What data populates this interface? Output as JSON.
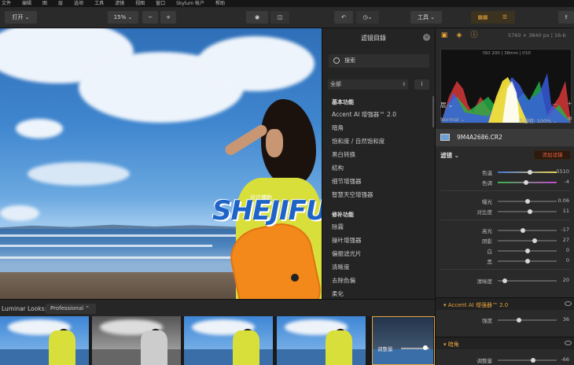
{
  "menu": [
    "文件",
    "编辑",
    "图",
    "层",
    "选项",
    "工具",
    "滤镜",
    "视图",
    "窗口",
    "Skylum 帐户",
    "帮助"
  ],
  "toolbar": {
    "open": "打开 ⌄",
    "zoom": "15% ⌄",
    "zoom_out": "−",
    "zoom_in": "+",
    "tools": "工具 ⌄"
  },
  "canvas": {
    "watermark": "SHEJIFUZHU",
    "watermark_small": "设计辅助"
  },
  "filters": {
    "title": "滤镜目錄",
    "search_placeholder": "搜索",
    "category": "全部",
    "info": "i",
    "sections": [
      {
        "title": "基本功能",
        "items": [
          "Accent AI 增强器™ 2.0",
          "暗角",
          "饱和度 / 自然饱和度",
          "黑白转换",
          "結构",
          "细节增强器",
          "智慧天空增强器"
        ]
      },
      {
        "title": "修补功能",
        "items": [
          "除霧",
          "操叶增强器",
          "偏振滤光片",
          "清晰度",
          "去除色偏",
          "柔化"
        ]
      }
    ]
  },
  "right": {
    "image_info": "5760 × 3840 px | 16-b",
    "hist_info": "ISO 200 | 38mm | f/10",
    "layers_title": "层 ⌄",
    "blend": "Normal ⌄",
    "opacity": "不透明: 100% ⌄",
    "file_name": "9M4A2686.CR2",
    "filters_title": "滤镜 ⌄",
    "add_filter": "添加滤镜",
    "sliders1": [
      {
        "label": "色温",
        "value": "5510",
        "pos": 0.55
      },
      {
        "label": "色调",
        "value": "-4",
        "pos": 0.48
      }
    ],
    "sliders2": [
      {
        "label": "曝光",
        "value": "0.06",
        "pos": 0.51
      },
      {
        "label": "对比度",
        "value": "11",
        "pos": 0.55
      }
    ],
    "sliders3": [
      {
        "label": "高光",
        "value": "-17",
        "pos": 0.43
      },
      {
        "label": "阴影",
        "value": "27",
        "pos": 0.62
      },
      {
        "label": "白",
        "value": "0",
        "pos": 0.5
      },
      {
        "label": "黑",
        "value": "0",
        "pos": 0.5
      }
    ],
    "slider_clarity": {
      "label": "清晰度",
      "value": "20",
      "pos": 0.12
    },
    "accent_title": "Accent AI 增强器™ 2.0",
    "accent_slider": {
      "label": "强度",
      "value": "36",
      "pos": 0.36
    },
    "vignette_title": "暗角",
    "vignette_slider": {
      "label": "调整量",
      "value": "-66",
      "pos": 0.6
    }
  },
  "looks": {
    "label": "Luminar Looks:",
    "preset": "Professional ⌃",
    "adjust_label": "调整量"
  },
  "colors": {
    "accent": "#e7a33a"
  }
}
